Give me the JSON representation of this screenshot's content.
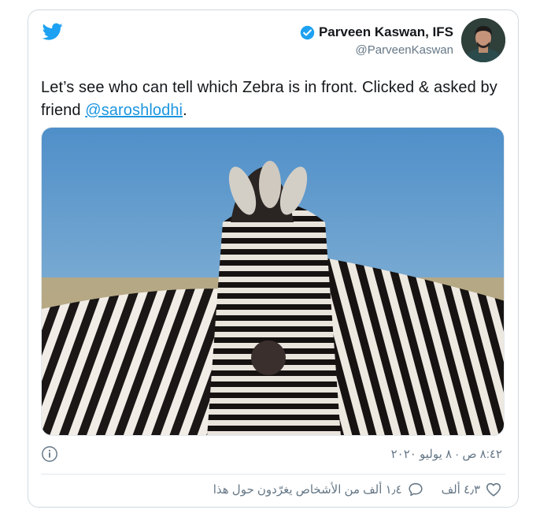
{
  "tweet": {
    "author_name": "Parveen Kaswan, IFS",
    "handle": "@ParveenKaswan",
    "text_before": "Let’s see who can tell which Zebra is in front. Clicked & asked by friend ",
    "mention": "@saroshlodhi",
    "text_after": ".",
    "timestamp": "٨:٤٢ ص · ٨ يوليو ٢٠٢٠",
    "likes": "٤٫٣ ألف",
    "replies": "١٫٤ ألف من الأشخاص يغرّدون حول هذا"
  },
  "icons": {
    "logo": "twitter-bird-icon",
    "verified": "verified-badge-icon",
    "info": "info-icon",
    "like": "heart-icon",
    "reply": "speech-bubble-icon"
  },
  "colors": {
    "twitter_blue": "#1da1f2",
    "link": "#1b95e0",
    "muted": "#657786",
    "border": "#cfd9de"
  }
}
